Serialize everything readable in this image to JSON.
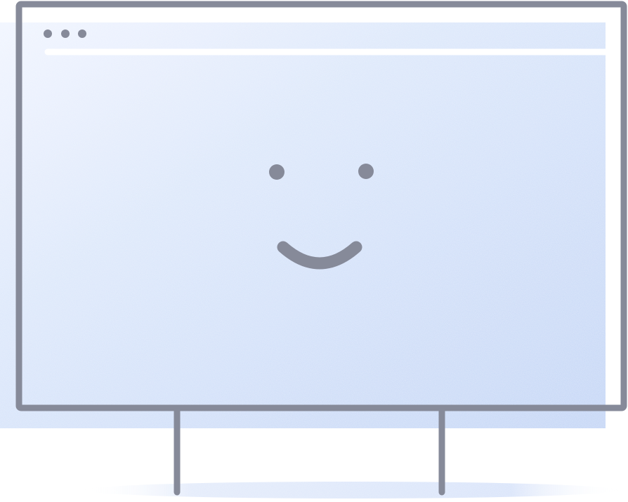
{
  "illustration": {
    "subject": "smiling-browser-window-on-stand",
    "colors": {
      "outline": "#868a99",
      "panel_light": "#eef3ff",
      "panel_dark": "#c6d7f7",
      "address_bar": "#ffffff",
      "ground_shadow": "#dde7fb"
    },
    "window_controls": [
      "dot-icon",
      "dot-icon",
      "dot-icon"
    ],
    "face": {
      "eyes": [
        "dot-icon",
        "dot-icon"
      ],
      "mouth": "smile-icon"
    }
  }
}
